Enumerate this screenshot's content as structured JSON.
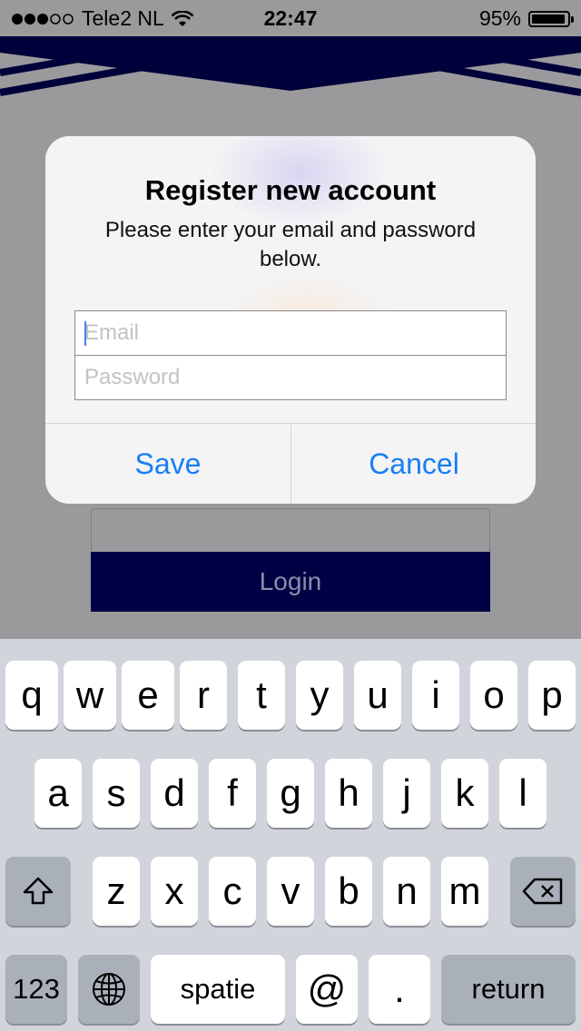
{
  "status_bar": {
    "carrier": "Tele2 NL",
    "time": "22:47",
    "battery_percent": "95%",
    "battery_level": 0.95
  },
  "background": {
    "login_label": "Login"
  },
  "alert": {
    "title": "Register new account",
    "message": "Please enter your email and password below.",
    "email_placeholder": "Email",
    "password_placeholder": "Password",
    "save_label": "Save",
    "cancel_label": "Cancel"
  },
  "keyboard": {
    "row1": [
      "q",
      "w",
      "e",
      "r",
      "t",
      "y",
      "u",
      "i",
      "o",
      "p"
    ],
    "row2": [
      "a",
      "s",
      "d",
      "f",
      "g",
      "h",
      "j",
      "k",
      "l"
    ],
    "row3": [
      "z",
      "x",
      "c",
      "v",
      "b",
      "n",
      "m"
    ],
    "numbers_label": "123",
    "space_label": "spatie",
    "at_label": "@",
    "dot_label": ".",
    "return_label": "return",
    "globe_icon": "globe-icon",
    "shift_icon": "shift-icon",
    "delete_icon": "backspace-icon"
  },
  "colors": {
    "accent": "#1a7ef5",
    "brand_navy": "#000044"
  }
}
